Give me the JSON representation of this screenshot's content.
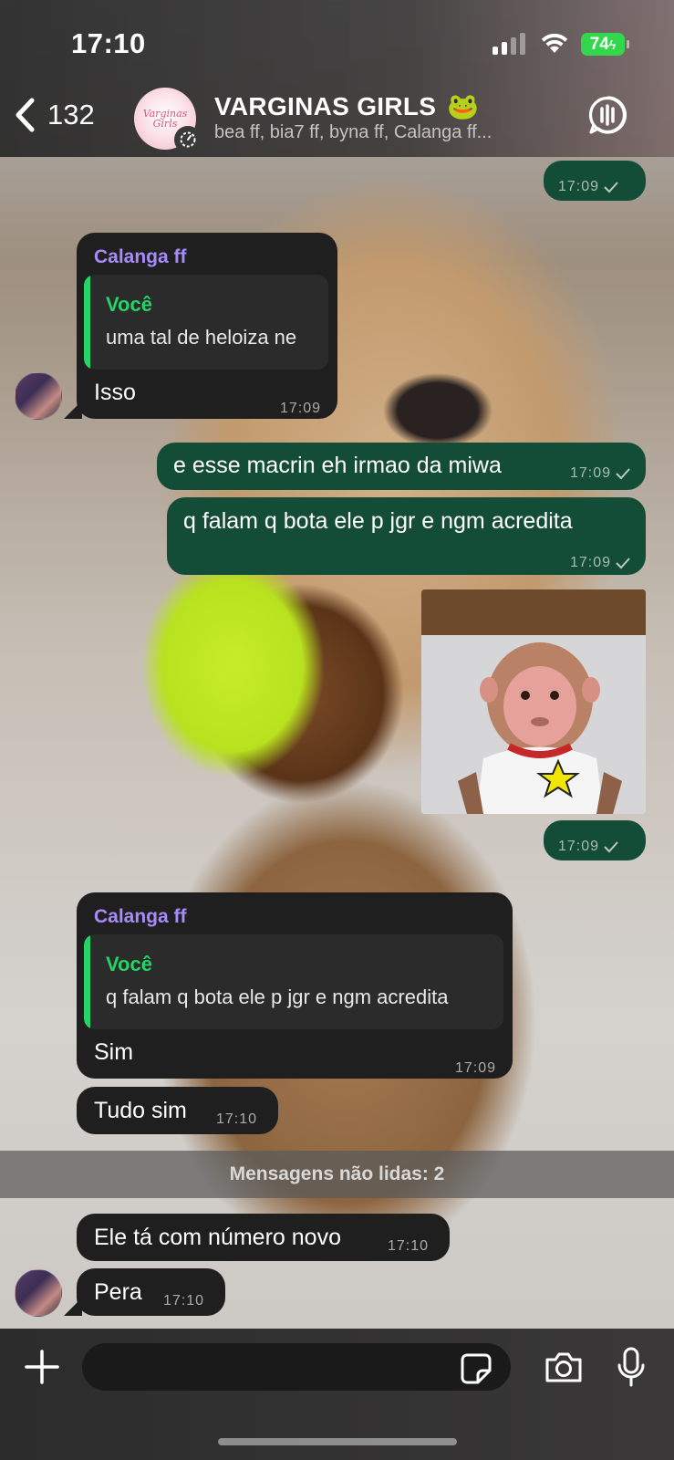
{
  "status_bar": {
    "time": "17:10",
    "battery": "74"
  },
  "header": {
    "back_count": "132",
    "group_logo": "Varginas Girls",
    "title": "VARGINAS GIRLS",
    "title_emoji": "🐸",
    "members": "bea ff, bia7 ff, byna ff, Calanga ff..."
  },
  "messages": {
    "m1": {
      "time": "17:09"
    },
    "m2": {
      "sender": "Calanga ff",
      "quote_name": "Você",
      "quote_text": "uma tal de heloiza ne",
      "text": "Isso",
      "time": "17:09"
    },
    "m3": {
      "text": "e esse macrin eh irmao da miwa",
      "time": "17:09"
    },
    "m4": {
      "text": "q falam q bota ele p jgr e ngm acredita",
      "time": "17:09"
    },
    "m5": {
      "time": "17:09"
    },
    "m6": {
      "sender": "Calanga ff",
      "quote_name": "Você",
      "quote_text": "q falam q bota ele p jgr e ngm acredita",
      "text": "Sim",
      "time": "17:09"
    },
    "m7": {
      "text": "Tudo sim",
      "time": "17:10"
    },
    "m8": {
      "text": "Ele tá com número novo",
      "time": "17:10"
    },
    "m9": {
      "text": "Pera",
      "time": "17:10"
    }
  },
  "unread": {
    "label": "Mensagens não lidas: 2"
  },
  "input": {
    "placeholder": ""
  },
  "colors": {
    "incoming_bubble": "#1f1f1f",
    "outgoing_bubble": "#144d37",
    "sender_name": "#a78bfa",
    "quote_accent": "#25d366",
    "battery": "#32d74b"
  },
  "icons": [
    "back-chevron-icon",
    "disappearing-timer-icon",
    "call-icon",
    "check-icon",
    "plus-icon",
    "sticker-icon",
    "camera-icon",
    "microphone-icon",
    "signal-icon",
    "wifi-icon",
    "battery-icon"
  ]
}
